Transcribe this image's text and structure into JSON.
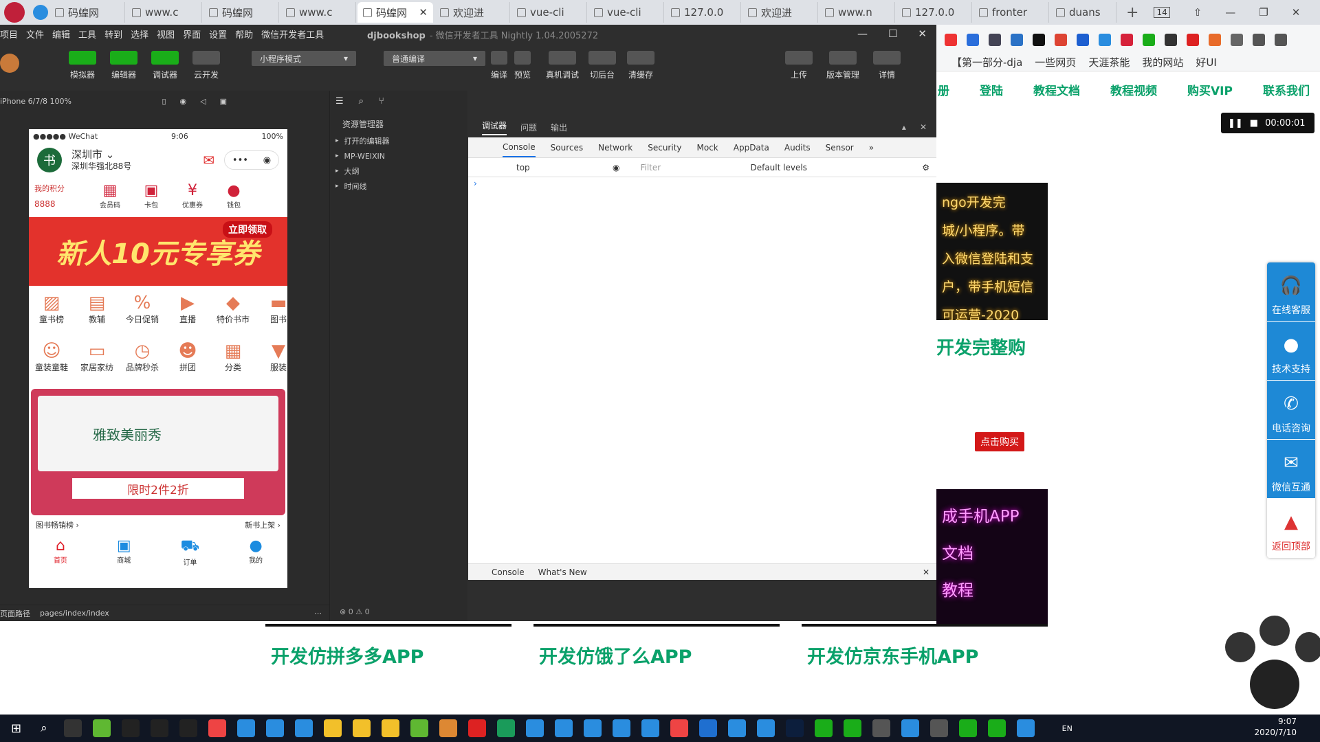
{
  "browser": {
    "tabs": [
      {
        "label": "码蝗网"
      },
      {
        "label": "www.c"
      },
      {
        "label": "码蝗网"
      },
      {
        "label": "www.c"
      },
      {
        "label": "码蝗网"
      },
      {
        "label": "欢迎进"
      },
      {
        "label": "vue-cli"
      },
      {
        "label": "vue-cli"
      },
      {
        "label": "127.0.0"
      },
      {
        "label": "欢迎进"
      },
      {
        "label": "www.n"
      },
      {
        "label": "127.0.0"
      },
      {
        "label": "fronter"
      },
      {
        "label": "duans"
      }
    ],
    "tab_count": "14",
    "new_tab": "+",
    "bookmarks": [
      "【第一部分-dja",
      "一些网页",
      "天涯茶能",
      "我的网站",
      "好UI"
    ]
  },
  "site": {
    "nav": [
      "册",
      "登陆",
      "教程文档",
      "教程视频",
      "购买VIP",
      "联系我们"
    ],
    "recording_time": "00:00:01",
    "card1_lines": [
      "ngo开发完",
      "城/小程序。带",
      "入微信登陆和支",
      "户，带手机短信",
      "可运营-2020"
    ],
    "heading": "开发完整购",
    "buy_button": "点击购买",
    "card2_lines": [
      "成手机APP",
      "文档",
      "教程"
    ],
    "courses": [
      "开发仿拼多多APP",
      "开发仿饿了么APP",
      "开发仿京东手机APP"
    ],
    "side_service": [
      "在线客服",
      "技术支持",
      "电话咨询",
      "微信互通",
      "返回顶部"
    ]
  },
  "ide": {
    "menu": [
      "项目",
      "文件",
      "编辑",
      "工具",
      "转到",
      "选择",
      "视图",
      "界面",
      "设置",
      "帮助",
      "微信开发者工具"
    ],
    "title": "djbookshop",
    "subtitle": "- 微信开发者工具 Nightly 1.04.2005272",
    "toolbar": {
      "simulator": "模拟器",
      "editor": "编辑器",
      "debugger": "调试器",
      "cloud": "云开发",
      "mode": "小程序模式",
      "compile_mode": "普通编译",
      "compile": "编译",
      "preview": "预览",
      "real_debug": "真机调试",
      "background": "切后台",
      "clear_cache": "清缓存",
      "upload": "上传",
      "version": "版本管理",
      "details": "详情"
    },
    "device": "iPhone 6/7/8 100%",
    "explorer_title": "资源管理器",
    "explorer_items": [
      "打开的编辑器",
      "MP-WEIXIN",
      "大纲",
      "时间线"
    ],
    "footer_path": "页面路径",
    "footer_page": "pages/index/index",
    "error_count": "0",
    "warning_count": "0"
  },
  "phone": {
    "carrier": "●●●●● WeChat",
    "time": "9:06",
    "battery": "100%",
    "avatar": "书",
    "city": "深圳市",
    "address": "深圳华强北88号",
    "points_label": "我的积分",
    "points": "8888",
    "quick": [
      "会员码",
      "卡包",
      "优惠券",
      "钱包"
    ],
    "banner": "新人10元专享券",
    "banner_btn": "立即领取",
    "grid": [
      "童书榜",
      "教辅",
      "今日促销",
      "直播",
      "特价书市",
      "图书",
      "童装童鞋",
      "家居家纺",
      "品牌秒杀",
      "拼团",
      "分类",
      "服装"
    ],
    "ad_title": "雅致美丽秀",
    "ad_promo": "限时2件2折",
    "links": [
      "图书畅销榜",
      "新书上架"
    ],
    "tabs": [
      "首页",
      "商城",
      "订单",
      "我的"
    ]
  },
  "devtools": {
    "header_tabs": [
      "调试器",
      "问题",
      "输出"
    ],
    "tabs": [
      "Console",
      "Sources",
      "Network",
      "Security",
      "Mock",
      "AppData",
      "Audits",
      "Sensor"
    ],
    "context": "top",
    "filter_placeholder": "Filter",
    "levels": "Default levels",
    "bottom_tabs": [
      "Console",
      "What's New"
    ]
  },
  "taskbar": {
    "lang": "EN",
    "time": "9:07",
    "date": "2020/7/10"
  }
}
